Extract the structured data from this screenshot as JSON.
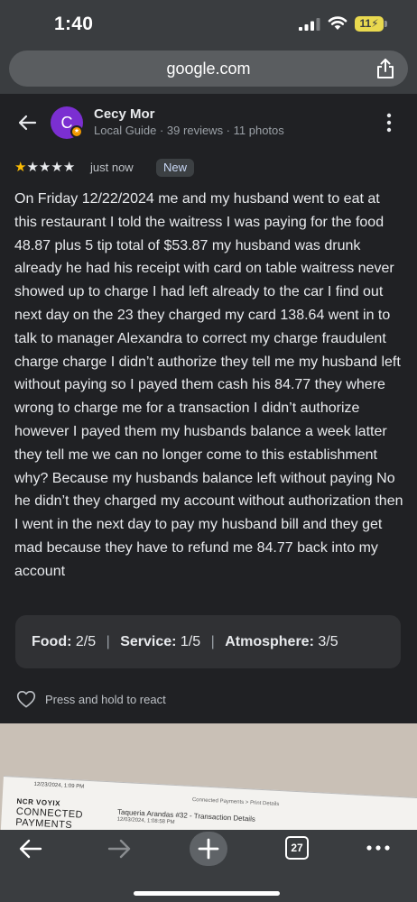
{
  "status_bar": {
    "time": "1:40",
    "battery": "11",
    "icons": [
      "signal-icon",
      "wifi-icon",
      "battery-icon"
    ]
  },
  "browser": {
    "url": "google.com",
    "toolbar": {
      "tab_count": "27",
      "icons": [
        "back-icon",
        "forward-icon",
        "new-tab-icon",
        "tabs-icon",
        "more-icon"
      ]
    }
  },
  "reviewer": {
    "initial": "C",
    "name": "Cecy Mor",
    "meta": "Local Guide · 39 reviews · 11 photos",
    "avatar_color": "#7b2fd1"
  },
  "review": {
    "rating": 1,
    "max_rating": 5,
    "time": "just now",
    "badge": "New",
    "text": "On Friday 12/22/2024 me and my husband went to eat at this restaurant I told the waitress I was paying for the food 48.87 plus 5 tip total of $53.87 my husband was drunk already he had his receipt with card on table waitress never showed up to charge I had left already to the car I find out next day on the 23 they charged my card 138.64 went in to talk to manager Alexandra to correct my charge fraudulent charge charge I didn’t authorize they tell me my husband left without paying so I payed them cash his 84.77 they where wrong to charge me for a transaction I didn’t authorize however I payed them my husbands balance a week latter they tell me we can no longer come to this establishment why? Because my husbands balance left without paying No he didn’t they charged my account without authorization then I went in the next day to pay my husband bill and they get mad because they have to refund me 84.77 back into my account",
    "scores": {
      "food_label": "Food:",
      "food_value": "2/5",
      "service_label": "Service:",
      "service_value": "1/5",
      "atmosphere_label": "Atmosphere:",
      "atmosphere_value": "3/5"
    },
    "react_text": "Press and hold to react"
  },
  "photo": {
    "receipt_date": "12/23/2024, 1:09 PM",
    "receipt_brand": "NCR VOYIX",
    "receipt_connected": "CONNECTED",
    "receipt_payments": "PAYMENTS",
    "receipt_breadcrumb": "Connected Payments > Print Details",
    "receipt_title": "Taqueria Arandas #32 - Transaction Details",
    "receipt_subtitle": "12/03/2024, 1:08:58 PM"
  },
  "colors": {
    "page_bg": "#202124",
    "chrome_bg": "#3a3d40",
    "star": "#fbbc04",
    "battery": "#e9d94f"
  }
}
